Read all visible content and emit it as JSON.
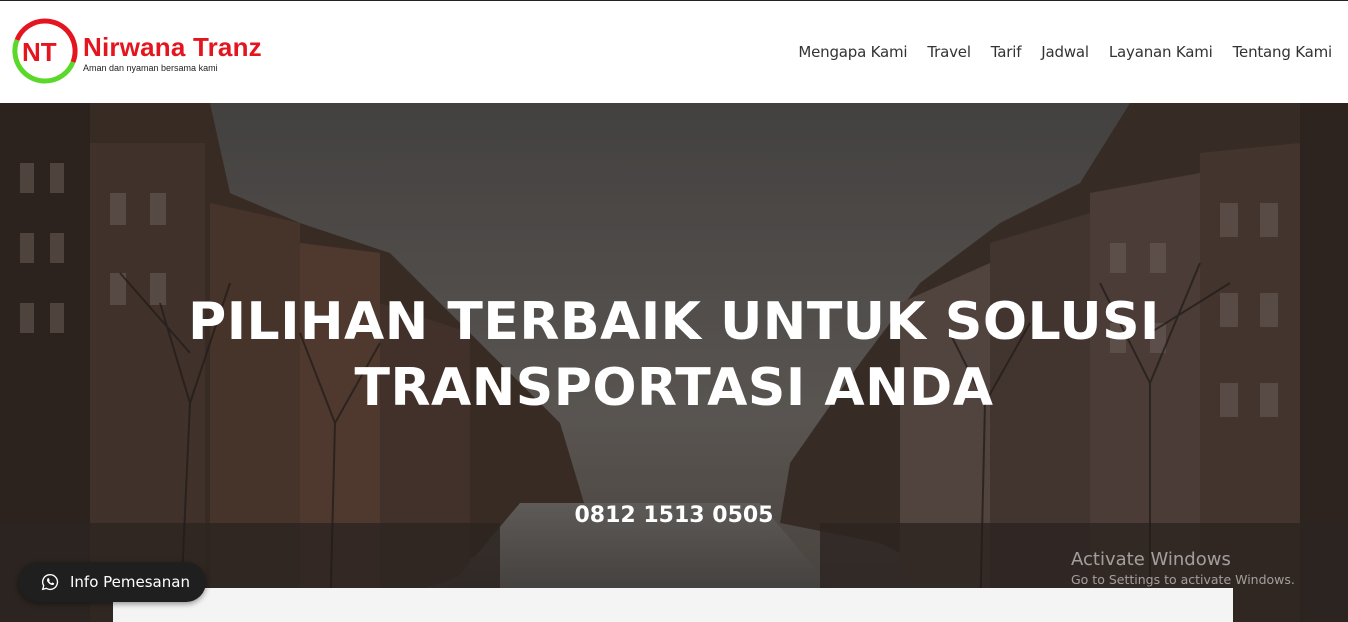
{
  "brand": {
    "logo_letters": "NT",
    "name": "Nirwana Tranz",
    "tagline": "Aman dan nyaman bersama kami",
    "accent_red": "#e4151f",
    "accent_green": "#5ad92a"
  },
  "nav": {
    "items": [
      {
        "label": "Mengapa Kami"
      },
      {
        "label": "Travel"
      },
      {
        "label": "Tarif"
      },
      {
        "label": "Jadwal"
      },
      {
        "label": "Layanan Kami"
      },
      {
        "label": "Tentang Kami"
      }
    ]
  },
  "hero": {
    "title_line1": "PILIHAN TERBAIK UNTUK SOLUSI",
    "title_line2": "TRANSPORTASI ANDA",
    "phone": "0812 1513 0505",
    "background": "canal-street-photo"
  },
  "whatsapp": {
    "icon": "whatsapp-icon",
    "label": "Info Pemesanan"
  },
  "os_watermark": {
    "title": "Activate Windows",
    "subtitle": "Go to Settings to activate Windows."
  }
}
